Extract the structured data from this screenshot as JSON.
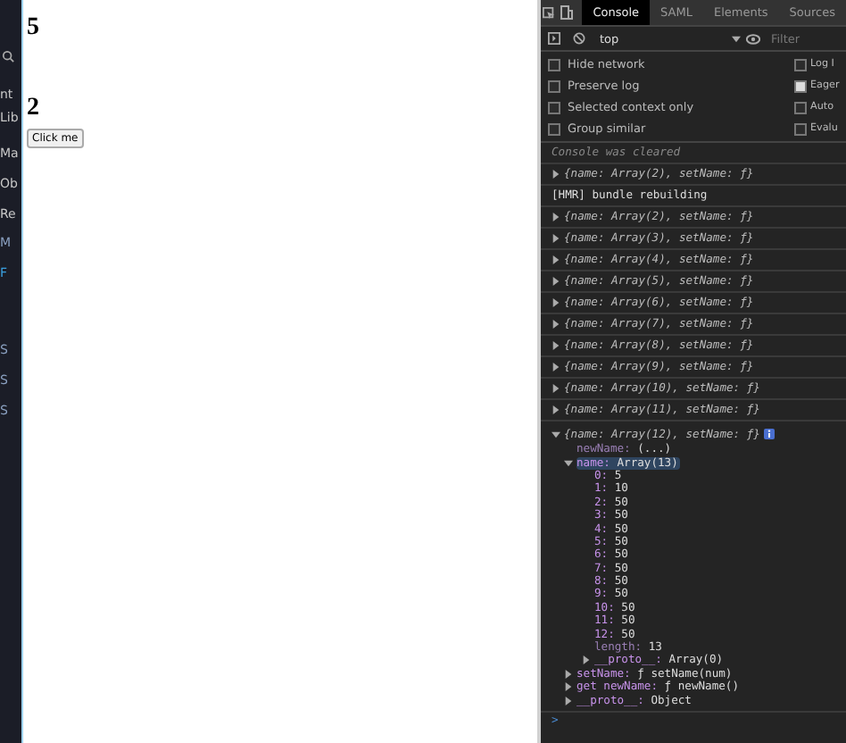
{
  "side_strip": {
    "items": [
      {
        "text": "nt",
        "color": "#c8c8c8"
      },
      {
        "text": "Lib",
        "color": "#c8c8c8"
      },
      {
        "text": "Ma",
        "color": "#c8c8c8"
      },
      {
        "text": "Ob",
        "color": "#c8c8c8"
      },
      {
        "text": "Re",
        "color": "#c8c8c8"
      },
      {
        "text": "M",
        "color": "#8aa0c0"
      },
      {
        "text": "F",
        "color": "#3aa0e0"
      },
      {
        "text": "S",
        "color": "#8aa0c0"
      },
      {
        "text": "S",
        "color": "#8aa0c0"
      },
      {
        "text": "S",
        "color": "#8aa0c0"
      }
    ]
  },
  "page": {
    "counters": [
      "5",
      "2"
    ],
    "button": "Click me"
  },
  "devtools": {
    "tabs": [
      {
        "label": "Console",
        "selected": true
      },
      {
        "label": "SAML",
        "selected": false
      },
      {
        "label": "Elements",
        "selected": false
      },
      {
        "label": "Sources",
        "selected": false
      }
    ],
    "context": "top",
    "filter": {
      "placeholder": "Filter"
    },
    "settings_left": [
      {
        "label": "Hide network",
        "checked": false
      },
      {
        "label": "Preserve log",
        "checked": false
      },
      {
        "label": "Selected context only",
        "checked": false
      },
      {
        "label": "Group similar",
        "checked": false
      }
    ],
    "settings_right": [
      {
        "label": "Log I",
        "checked": false
      },
      {
        "label": "Eager",
        "checked": true
      },
      {
        "label": "Auto",
        "checked": false
      },
      {
        "label": "Evalu",
        "checked": false
      }
    ],
    "console": [
      {
        "kind": "info",
        "text": "Console was cleared"
      },
      {
        "kind": "object",
        "text": "{name: Array(2), setName: ƒ}",
        "expanded": false
      },
      {
        "kind": "text",
        "text": "[HMR] bundle rebuilding"
      },
      {
        "kind": "object",
        "text": "{name: Array(2), setName: ƒ}",
        "expanded": false
      },
      {
        "kind": "object",
        "text": "{name: Array(3), setName: ƒ}",
        "expanded": false
      },
      {
        "kind": "object",
        "text": "{name: Array(4), setName: ƒ}",
        "expanded": false
      },
      {
        "kind": "object",
        "text": "{name: Array(5), setName: ƒ}",
        "expanded": false
      },
      {
        "kind": "object",
        "text": "{name: Array(6), setName: ƒ}",
        "expanded": false
      },
      {
        "kind": "object",
        "text": "{name: Array(7), setName: ƒ}",
        "expanded": false
      },
      {
        "kind": "object",
        "text": "{name: Array(8), setName: ƒ}",
        "expanded": false
      },
      {
        "kind": "object",
        "text": "{name: Array(9), setName: ƒ}",
        "expanded": false
      },
      {
        "kind": "object",
        "text": "{name: Array(10), setName: ƒ}",
        "expanded": false
      },
      {
        "kind": "object",
        "text": "{name: Array(11), setName: ƒ}",
        "expanded": false
      },
      {
        "kind": "object",
        "text": "{name: Array(12), setName: ƒ}",
        "expanded": true,
        "children": [
          {
            "kind": "leaf",
            "key": "newName:",
            "value": "(...)",
            "dim": true
          },
          {
            "kind": "node",
            "key": "name:",
            "value": "Array(13)",
            "expanded": true,
            "selected": true,
            "children": [
              {
                "kind": "leaf",
                "key": "0:",
                "value": "5",
                "dim": false
              },
              {
                "kind": "leaf",
                "key": "1:",
                "value": "10",
                "dim": false
              },
              {
                "kind": "leaf",
                "key": "2:",
                "value": "50",
                "dim": false
              },
              {
                "kind": "leaf",
                "key": "3:",
                "value": "50",
                "dim": false
              },
              {
                "kind": "leaf",
                "key": "4:",
                "value": "50",
                "dim": false
              },
              {
                "kind": "leaf",
                "key": "5:",
                "value": "50",
                "dim": false
              },
              {
                "kind": "leaf",
                "key": "6:",
                "value": "50",
                "dim": false
              },
              {
                "kind": "leaf",
                "key": "7:",
                "value": "50",
                "dim": false
              },
              {
                "kind": "leaf",
                "key": "8:",
                "value": "50",
                "dim": false
              },
              {
                "kind": "leaf",
                "key": "9:",
                "value": "50",
                "dim": false
              },
              {
                "kind": "leaf",
                "key": "10:",
                "value": "50",
                "dim": false
              },
              {
                "kind": "leaf",
                "key": "11:",
                "value": "50",
                "dim": false
              },
              {
                "kind": "leaf",
                "key": "12:",
                "value": "50",
                "dim": false
              },
              {
                "kind": "leaf",
                "key": "length:",
                "value": "13",
                "dim": true
              },
              {
                "kind": "node",
                "key": "__proto__:",
                "value": "Array(0)",
                "expanded": false,
                "selected": false
              }
            ]
          },
          {
            "kind": "node",
            "key": "setName:",
            "value": "ƒ setName(num)",
            "expanded": false,
            "selected": false
          },
          {
            "kind": "node",
            "key": "get newName:",
            "value": "ƒ newName()",
            "expanded": false,
            "selected": false
          },
          {
            "kind": "node",
            "key": "__proto__:",
            "value": "Object",
            "expanded": false,
            "selected": false
          }
        ]
      }
    ],
    "prompt": ">"
  }
}
